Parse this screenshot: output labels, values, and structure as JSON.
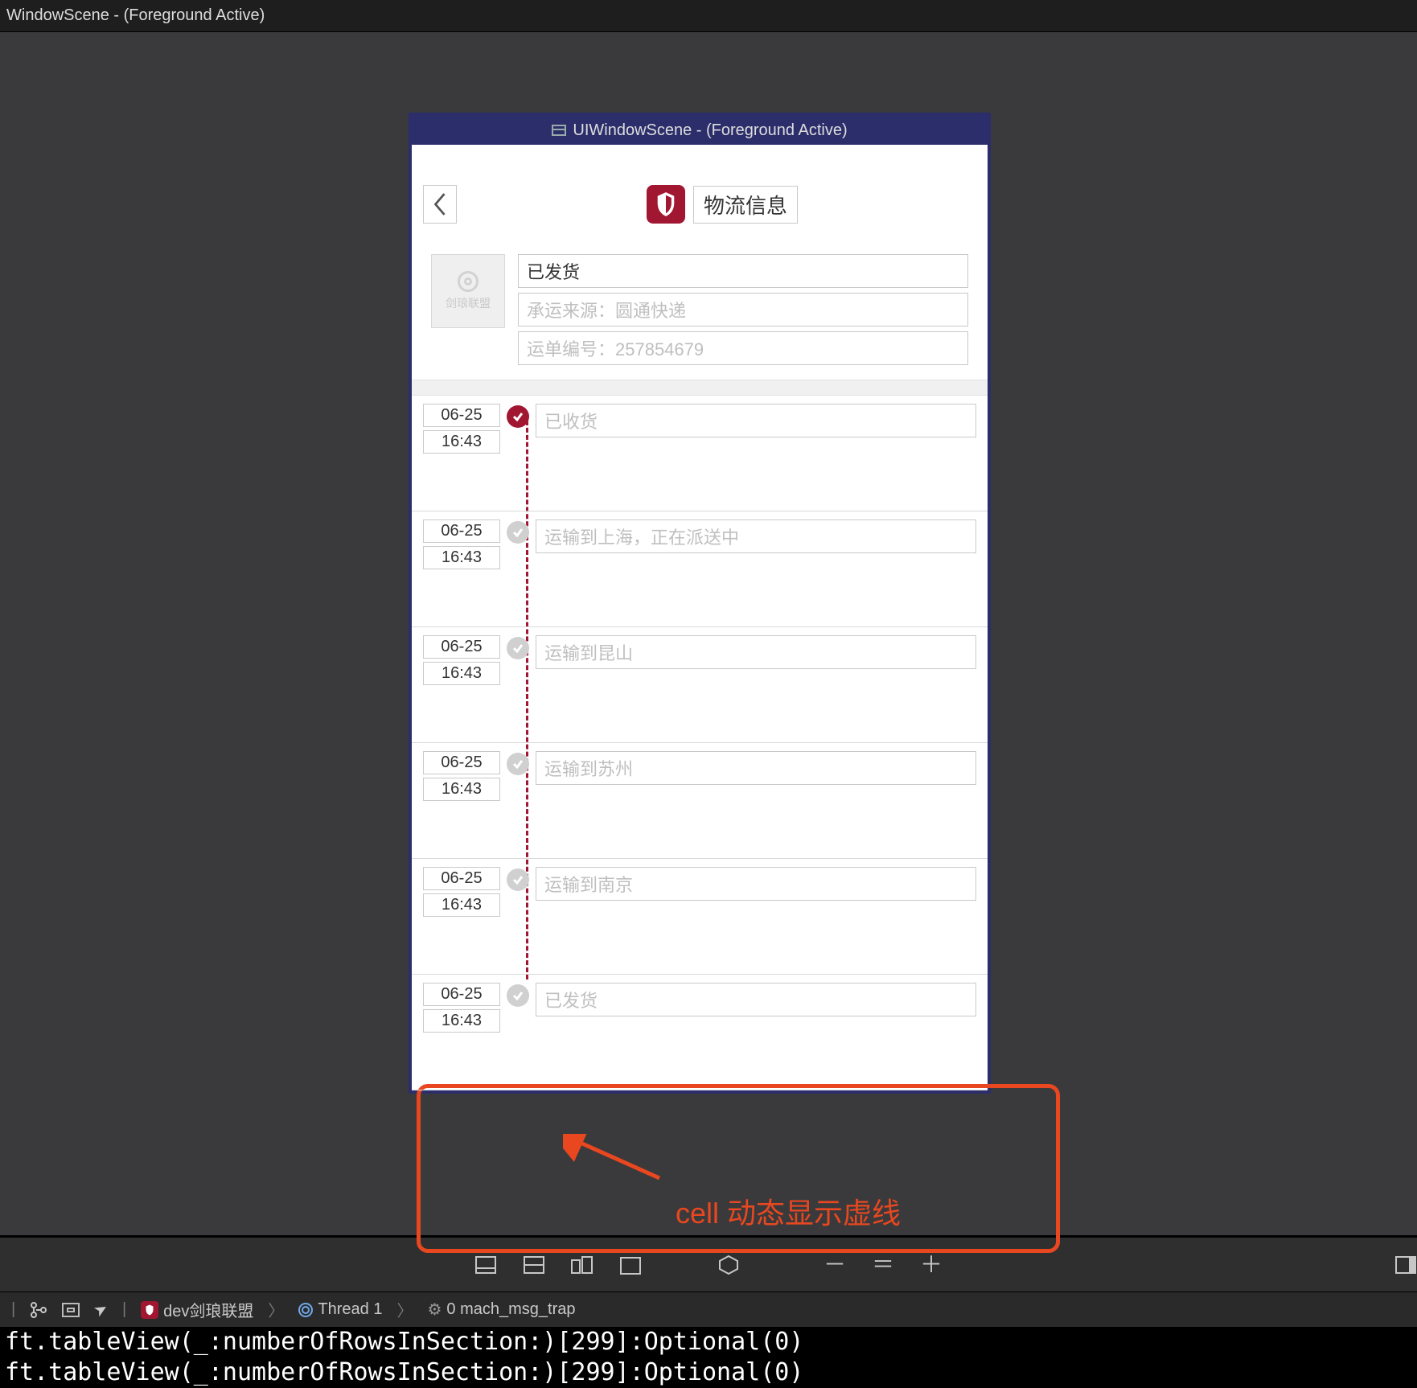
{
  "outer_title": "WindowScene - (Foreground Active)",
  "sim_title": "UIWindowScene - (Foreground Active)",
  "header": {
    "title": "物流信息"
  },
  "thumb_label": "剑琅联盟",
  "summary": {
    "status": "已发货",
    "carrier": "承运来源：圆通快递",
    "tracking": "运单编号：257854679"
  },
  "timeline": [
    {
      "date": "06-25",
      "time": "16:43",
      "text": "已收货",
      "active": true
    },
    {
      "date": "06-25",
      "time": "16:43",
      "text": "运输到上海，正在派送中",
      "active": false
    },
    {
      "date": "06-25",
      "time": "16:43",
      "text": "运输到昆山",
      "active": false
    },
    {
      "date": "06-25",
      "time": "16:43",
      "text": "运输到苏州",
      "active": false
    },
    {
      "date": "06-25",
      "time": "16:43",
      "text": "运输到南京",
      "active": false
    },
    {
      "date": "06-25",
      "time": "16:43",
      "text": "已发货",
      "active": false
    }
  ],
  "annotation": "cell 动态显示虚线",
  "breadcrumb": {
    "app": "dev剑琅联盟",
    "thread": "Thread 1",
    "frame": "0 mach_msg_trap"
  },
  "console_lines": [
    "ft.tableView(_:numberOfRowsInSection:)[299]:Optional(0)",
    "ft.tableView(_:numberOfRowsInSection:)[299]:Optional(0)"
  ]
}
